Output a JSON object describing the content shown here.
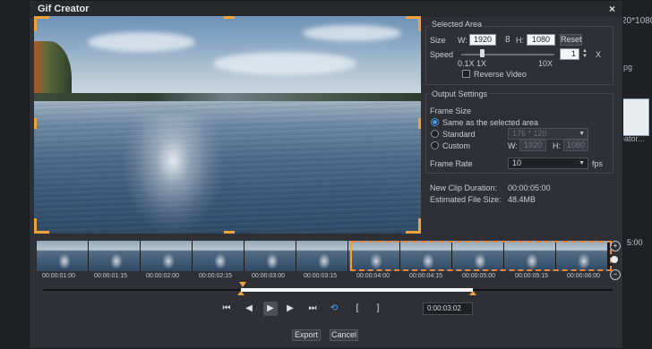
{
  "background": {
    "resolution_text": "20*1080",
    "thumb_ext": "jpg",
    "thumb_label": "eator...",
    "time_text": "5:00"
  },
  "dialog": {
    "title": "Gif Creator",
    "close_glyph": "×"
  },
  "selected_area": {
    "title": "Selected Area",
    "size_label": "Size",
    "w_label": "W:",
    "w_value": "1920",
    "link_glyph": "8",
    "h_label": "H:",
    "h_value": "1080",
    "reset_label": "Reset",
    "speed_label": "Speed",
    "speed_value": "1",
    "speed_unit": "X",
    "speed_ticks": [
      "0.1X",
      "1X",
      "10X"
    ],
    "reverse_label": "Reverse Video",
    "reverse_checked": false
  },
  "output": {
    "title": "Output Settings",
    "frame_size_label": "Frame Size",
    "options": [
      {
        "label": "Same as the selected area",
        "selected": true
      },
      {
        "label": "Standard",
        "selected": false,
        "value": "176 * 120"
      },
      {
        "label": "Custom",
        "selected": false
      }
    ],
    "custom_w_label": "W:",
    "custom_w_value": "1920",
    "custom_h_label": "H:",
    "custom_h_value": "1080",
    "frame_rate_label": "Frame Rate",
    "frame_rate_value": "10",
    "frame_rate_unit": "fps"
  },
  "info": {
    "duration_label": "New Clip Duration:",
    "duration_value": "00:00:05:00",
    "size_label": "Estimated File Size:",
    "size_value": "48.4MB"
  },
  "timeline": {
    "ticks": [
      "00:00:01:00",
      "00:00:01:15",
      "00:00:02:00",
      "00:00:02:15",
      "00:00:03:00",
      "00:00:03:15",
      "00:00:04:00",
      "00:00:04:15",
      "00:00:05:00",
      "00:00:05:15",
      "00:00:06:00"
    ],
    "zoom_in": "+",
    "zoom_out": "−"
  },
  "controls": {
    "timecode": "0:00:03:02",
    "icons": [
      "go-start-icon",
      "step-back-icon",
      "play-icon",
      "step-forward-icon",
      "go-end-icon",
      "loop-icon",
      "mark-in-icon",
      "mark-out-icon"
    ]
  },
  "buttons": {
    "export": "Export",
    "cancel": "Cancel"
  },
  "colors": {
    "accent_orange": "#f2a23a",
    "accent_blue": "#4a9eea"
  }
}
